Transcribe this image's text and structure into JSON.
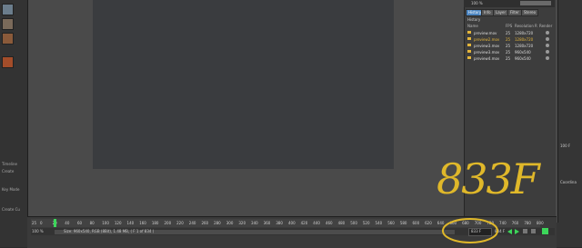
{
  "host": {
    "left_labels": [
      "Timeline",
      "Create",
      "Key Mode",
      "Create Cu"
    ],
    "right_labels": [
      "100 F",
      "Coordina"
    ]
  },
  "viewer": {
    "zoom": "100 %",
    "tabs": [
      "History",
      "Info",
      "Layer",
      "Filter",
      "Stereo"
    ],
    "active_tab": "History",
    "history_label": "History",
    "columns": {
      "name": "Name",
      "fps": "FPS",
      "resolution": "Resolution",
      "r": "R",
      "render": "Render"
    },
    "rows": [
      {
        "name": "preview.mov",
        "fps": "25",
        "resolution": "1280x720",
        "selected": false
      },
      {
        "name": "preview2.mov",
        "fps": "25",
        "resolution": "1280x720",
        "selected": true
      },
      {
        "name": "preview3.mov",
        "fps": "25",
        "resolution": "1280x720",
        "selected": false
      },
      {
        "name": "preview3.mov",
        "fps": "25",
        "resolution": "960x540",
        "selected": false
      },
      {
        "name": "preview4.mov",
        "fps": "25",
        "resolution": "960x540",
        "selected": false
      }
    ]
  },
  "timeline": {
    "start_frame": "25",
    "ticks": [
      "0",
      "20",
      "40",
      "60",
      "80",
      "100",
      "120",
      "140",
      "160",
      "180",
      "200",
      "220",
      "240",
      "260",
      "280",
      "300",
      "320",
      "340",
      "360",
      "380",
      "400",
      "420",
      "440",
      "460",
      "480",
      "500",
      "520",
      "540",
      "560",
      "580",
      "600",
      "620",
      "640",
      "660",
      "680",
      "700",
      "720",
      "740",
      "760",
      "780",
      "800"
    ],
    "zoom": "100 %",
    "status": "Size: 960x540, RGB (8Bit), 1.48 MB, ( F 1 of 834 )",
    "current_frame": "833 F",
    "end_frame": "834 F",
    "accent": "#3cd65a"
  },
  "annotation": {
    "text": "833F",
    "color": "#e0b82a"
  }
}
